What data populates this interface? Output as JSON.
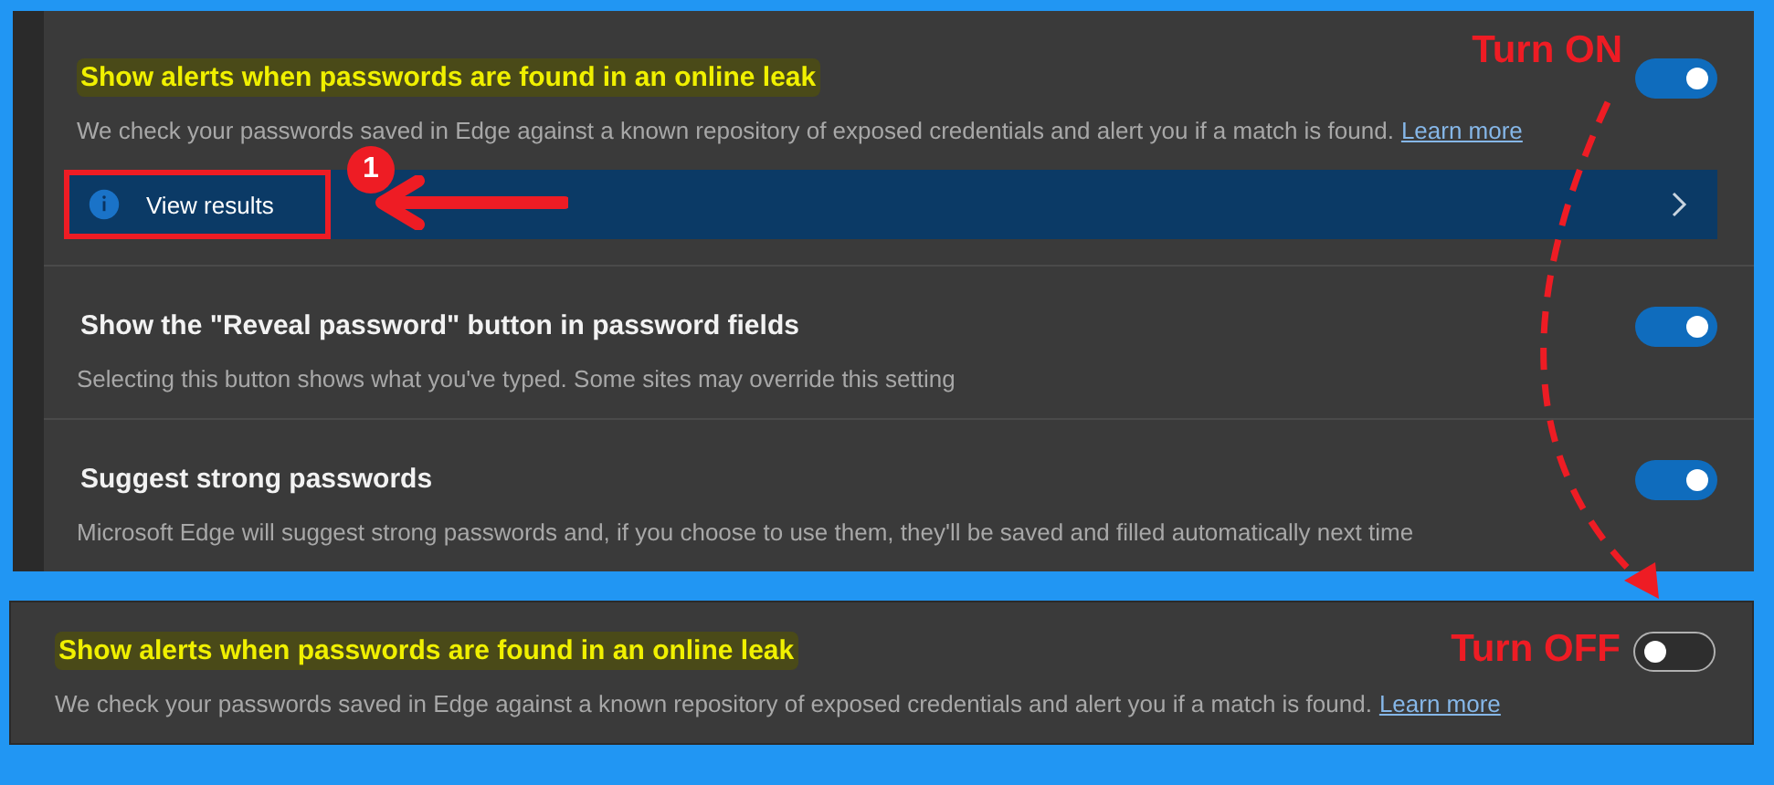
{
  "panels": [
    {
      "settings": [
        {
          "title": "Show alerts when passwords are found in an online leak",
          "highlighted": true,
          "description": "We check your passwords saved in Edge against a known repository of exposed credentials and alert you if a match is found.",
          "link": "Learn more",
          "on": true,
          "annotation": "Turn ON",
          "action": {
            "label": "View results",
            "marker": "1"
          }
        },
        {
          "title": "Show the \"Reveal password\" button in password fields",
          "highlighted": false,
          "description": "Selecting this button shows what you've typed. Some sites may override this setting",
          "on": true
        },
        {
          "title": "Suggest strong passwords",
          "highlighted": false,
          "description": "Microsoft Edge will suggest strong passwords and, if you choose to use them, they'll be saved and filled automatically next time",
          "on": true
        }
      ]
    },
    {
      "settings": [
        {
          "title": "Show alerts when passwords are found in an online leak",
          "highlighted": true,
          "description": "We check your passwords saved in Edge against a known repository of exposed credentials and alert you if a match is found.",
          "link": "Learn more",
          "on": false,
          "annotation": "Turn OFF"
        }
      ]
    }
  ]
}
